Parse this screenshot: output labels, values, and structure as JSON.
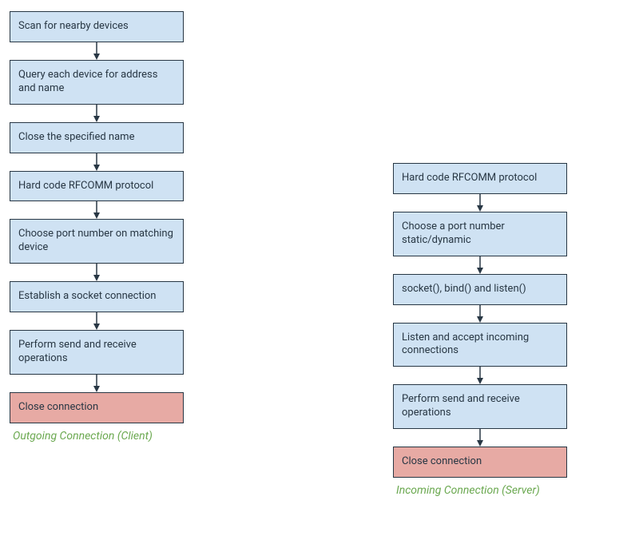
{
  "colors": {
    "box_blue": "#cfe2f3",
    "box_red": "#e7aaa4",
    "border": "#283744",
    "caption": "#6aa84f"
  },
  "left": {
    "caption": "Outgoing Connection (Client)",
    "steps": [
      {
        "label": "Scan for nearby devices",
        "type": "blue"
      },
      {
        "label": "Query each device for address and name",
        "type": "blue"
      },
      {
        "label": "Close the specified name",
        "type": "blue"
      },
      {
        "label": "Hard code RFCOMM protocol",
        "type": "blue"
      },
      {
        "label": "Choose port number on matching device",
        "type": "blue"
      },
      {
        "label": "Establish a socket connection",
        "type": "blue"
      },
      {
        "label": "Perform send and receive operations",
        "type": "blue"
      },
      {
        "label": "Close connection",
        "type": "red"
      }
    ]
  },
  "right": {
    "caption": "Incoming Connection (Server)",
    "steps": [
      {
        "label": "Hard code RFCOMM protocol",
        "type": "blue"
      },
      {
        "label": "Choose a port number static/dynamic",
        "type": "blue"
      },
      {
        "label": "socket(), bind() and listen()",
        "type": "blue"
      },
      {
        "label": "Listen and accept incoming connections",
        "type": "blue"
      },
      {
        "label": "Perform send and receive operations",
        "type": "blue"
      },
      {
        "label": "Close connection",
        "type": "red"
      }
    ]
  }
}
